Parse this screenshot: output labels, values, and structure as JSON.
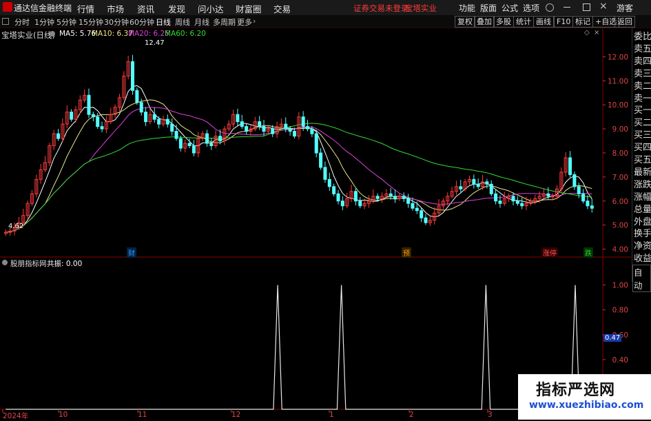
{
  "titlebar": {
    "app_name": "通达信金融终端",
    "menus": [
      "行情",
      "市场",
      "资讯",
      "发现",
      "问小达",
      "财富圈",
      "交易"
    ],
    "warning": "证券交易未登录",
    "stock_name": "宝塔实业",
    "right_menus": [
      "功能",
      "版面",
      "公式",
      "选项"
    ],
    "guest": "游客"
  },
  "toolbar": {
    "periods": [
      "分时",
      "1分钟",
      "5分钟",
      "15分钟",
      "30分钟",
      "60分钟",
      "日线",
      "周线",
      "月线",
      "多周期",
      "更多"
    ],
    "active_period": "日线",
    "right_buttons": [
      "复权",
      "叠加",
      "多股",
      "统计",
      "画线",
      "F10",
      "标记",
      "+自选",
      "返回"
    ]
  },
  "main_chart": {
    "title": "宝塔实业(日线)",
    "ma": [
      {
        "label": "MA5: 5.76",
        "color": "#ffffff"
      },
      {
        "label": "MA10: 6.37",
        "color": "#f0e68c"
      },
      {
        "label": "MA20: 6.25",
        "color": "#e040e0"
      },
      {
        "label": "MA60: 6.20",
        "color": "#33dd33"
      }
    ],
    "high_label": "12.47",
    "low_label": "4.62",
    "markers": [
      {
        "text": "财",
        "color": "#3399ff"
      },
      {
        "text": "预",
        "color": "#ff9900"
      },
      {
        "text": "涨停",
        "color": "#ff5555"
      },
      {
        "text": "跌",
        "color": "#33cc33"
      }
    ]
  },
  "sub_chart": {
    "title": "股朋指标网",
    "value_label": "共振: 0.00",
    "current_value": "0.47"
  },
  "side_panel": {
    "items": [
      "委比",
      "卖五",
      "卖四",
      "卖三",
      "卖二",
      "卖一",
      "买一",
      "买二",
      "买三",
      "买四",
      "买五",
      "最新",
      "涨跌",
      "涨幅",
      "总量",
      "外盘",
      "换手",
      "净资",
      "收益"
    ],
    "auto_label": "自动"
  },
  "x_labels": [
    "2024年",
    "10",
    "11",
    "12",
    "1",
    "2",
    "3"
  ],
  "watermark": {
    "line1": "指标严选网",
    "line2": "www.xuezhibiao.com"
  },
  "chart_data": [
    {
      "type": "candlestick",
      "title": "宝塔实业(日线)",
      "ylim": [
        3.7,
        12.7
      ],
      "y_ticks": [
        4.0,
        5.0,
        6.0,
        7.0,
        8.0,
        9.0,
        10.0,
        11.0,
        12.0
      ],
      "x_ticks": [
        "2024年",
        "10",
        "11",
        "12",
        "1",
        "2",
        "3"
      ],
      "close": [
        4.7,
        4.75,
        4.9,
        5.1,
        5.4,
        5.9,
        6.3,
        6.9,
        7.3,
        7.6,
        8.3,
        8.8,
        8.6,
        9.2,
        9.7,
        9.4,
        9.8,
        10.2,
        10.4,
        9.6,
        9.5,
        9.1,
        9.0,
        9.3,
        9.6,
        9.9,
        10.3,
        11.2,
        11.8,
        10.6,
        10.1,
        9.7,
        9.3,
        9.6,
        9.4,
        9.2,
        9.4,
        9.2,
        8.9,
        8.6,
        8.2,
        8.4,
        8.3,
        8.0,
        8.6,
        8.8,
        8.4,
        8.3,
        8.7,
        8.5,
        9.0,
        9.2,
        9.6,
        9.3,
        9.1,
        8.9,
        9.0,
        9.3,
        9.1,
        8.9,
        9.0,
        8.8,
        9.1,
        9.2,
        9.0,
        8.9,
        8.7,
        9.5,
        9.1,
        9.0,
        8.8,
        8.0,
        7.4,
        6.9,
        6.6,
        6.3,
        6.0,
        5.8,
        6.1,
        6.4,
        6.0,
        5.8,
        5.9,
        6.0,
        6.2,
        6.1,
        6.2,
        6.3,
        6.2,
        6.1,
        6.2,
        6.1,
        5.9,
        5.7,
        5.6,
        5.3,
        5.1,
        5.2,
        5.5,
        5.8,
        6.0,
        6.2,
        6.4,
        6.6,
        6.5,
        6.8,
        6.9,
        6.7,
        6.6,
        6.8,
        6.7,
        6.3,
        6.0,
        5.9,
        6.1,
        6.2,
        6.0,
        5.9,
        5.8,
        5.9,
        6.0,
        6.1,
        6.2,
        6.3,
        6.2,
        6.2,
        6.5,
        7.2,
        7.8,
        7.1,
        6.6,
        6.3,
        6.0,
        5.8,
        5.7
      ],
      "series": [
        {
          "name": "MA5",
          "value": 5.76
        },
        {
          "name": "MA10",
          "value": 6.37
        },
        {
          "name": "MA20",
          "value": 6.25
        },
        {
          "name": "MA60",
          "value": 6.2
        }
      ],
      "annotations": [
        "12.47",
        "4.62"
      ]
    },
    {
      "type": "line",
      "title": "股朋指标网",
      "ylim": [
        0,
        1.12
      ],
      "y_ticks": [
        0.4,
        0.6,
        0.8,
        1.0
      ],
      "values": [
        0,
        0,
        0,
        0,
        0,
        0,
        0,
        0,
        0,
        0,
        0,
        0,
        0,
        0,
        0,
        0,
        0,
        0,
        0,
        0,
        0,
        0,
        0,
        0,
        0,
        0,
        0,
        0,
        0,
        0,
        0,
        0,
        0,
        0,
        0,
        0,
        0,
        0,
        0,
        0,
        0,
        0,
        0,
        0,
        0,
        0,
        0,
        0,
        0,
        0,
        0,
        0,
        0,
        0,
        0,
        0,
        0,
        0,
        0,
        0,
        0,
        0,
        0,
        0,
        1,
        0,
        0,
        0,
        0,
        0,
        0,
        0,
        0,
        0,
        0,
        0,
        0,
        0,
        0,
        1,
        0,
        0,
        0,
        0,
        0,
        0,
        0,
        0,
        0,
        0,
        0,
        0,
        0,
        0,
        0,
        0,
        0,
        0,
        0,
        0,
        0,
        0,
        0,
        0,
        0,
        0,
        0,
        0,
        0,
        0,
        0,
        0,
        0,
        1,
        0,
        0,
        0,
        0,
        0,
        0,
        0,
        0,
        0,
        0,
        0,
        0,
        0,
        0,
        0,
        0,
        0,
        0,
        0,
        0,
        1,
        0,
        0,
        0,
        0
      ]
    }
  ]
}
